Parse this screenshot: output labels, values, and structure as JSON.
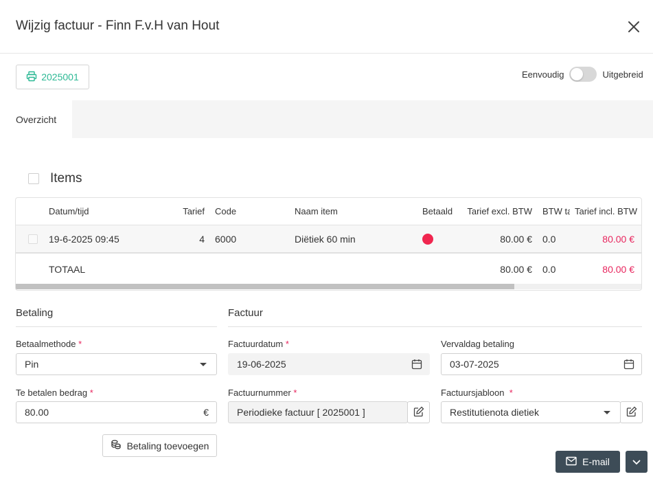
{
  "header": {
    "title": "Wijzig factuur - Finn F.v.H van Hout"
  },
  "toolbar": {
    "invoice_number": "2025001"
  },
  "mode_toggle": {
    "left_label": "Eenvoudig",
    "right_label": "Uitgebreid",
    "enabled": false
  },
  "overview": {
    "label": "Overzicht"
  },
  "items": {
    "title": "Items",
    "columns": {
      "datetime": "Datum/tijd",
      "tariff": "Tarief",
      "code": "Code",
      "name": "Naam item",
      "paid": "Betaald",
      "excl": "Tarief excl. BTW",
      "vat": "BTW ta",
      "incl": "Tarief incl. BTW"
    },
    "rows": [
      {
        "datetime": "19-6-2025 09:45",
        "tariff": "4",
        "code": "6000",
        "name": "Diëtiek 60 min",
        "paid_status": "unpaid",
        "paid_color": "#f0264f",
        "excl": "80.00 €",
        "vat": "0.0",
        "incl": "80.00 €"
      }
    ],
    "total": {
      "label": "TOTAAL",
      "excl": "80.00 €",
      "vat": "0.0",
      "incl": "80.00 €"
    }
  },
  "payment": {
    "title": "Betaling",
    "method_label": "Betaalmethode",
    "method_value": "Pin",
    "amount_label": "Te betalen bedrag",
    "amount_value": "80.00",
    "currency": "€",
    "add_payment_label": "Betaling toevoegen"
  },
  "invoice": {
    "title": "Factuur",
    "date_label": "Factuurdatum",
    "date_value": "19-06-2025",
    "due_label": "Vervaldag betaling",
    "due_value": "03-07-2025",
    "number_label": "Factuurnummer",
    "number_value": "Periodieke factuur [ 2025001 ]",
    "template_label": "Factuursjabloon",
    "template_value": "Restitutienota dietiek"
  },
  "footer": {
    "email_label": "E-mail"
  },
  "colors": {
    "accent": "#2bb894",
    "required": "#e8265e",
    "primary_button": "#3d4c57"
  }
}
